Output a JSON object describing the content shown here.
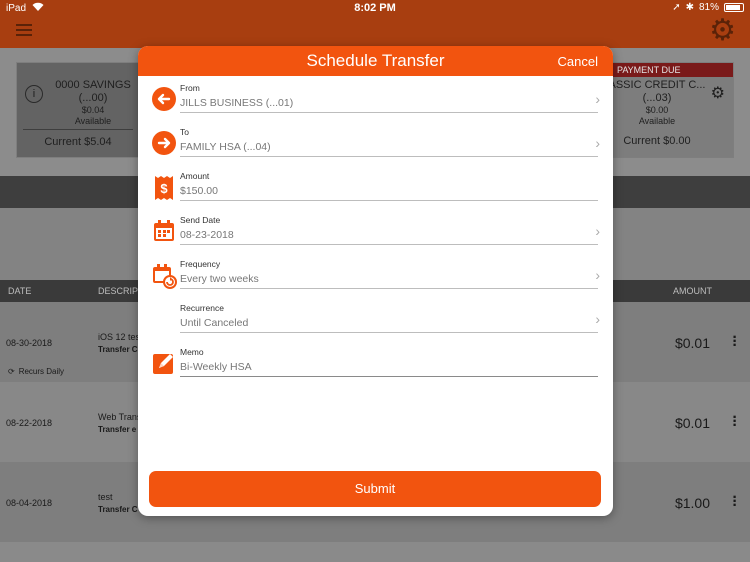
{
  "status_bar": {
    "device": "iPad",
    "time": "8:02 PM",
    "battery": "81%"
  },
  "background": {
    "left_account": {
      "name": "0000 SAVINGS",
      "mask": "(...00)",
      "balance": "$0.04",
      "available_label": "Available",
      "current": "Current $5.04"
    },
    "right_account": {
      "badge": "PAYMENT DUE",
      "name": "ASSIC CREDIT C...",
      "mask": "(...03)",
      "balance": "$0.00",
      "available_label": "Available",
      "current": "Current $0.00"
    },
    "table": {
      "col_date": "DATE",
      "col_desc": "DESCRIP",
      "col_amount": "AMOUNT",
      "rows": [
        {
          "date": "08-30-2018",
          "desc": "iOS 12 tes",
          "sub": "Transfer C",
          "amount": "$0.01",
          "recurs": "Recurs Daily"
        },
        {
          "date": "08-22-2018",
          "desc": "Web Trans",
          "sub": "Transfer e",
          "amount": "$0.01"
        },
        {
          "date": "08-04-2018",
          "desc": "test",
          "sub": "Transfer C",
          "amount": "$1.00"
        }
      ]
    }
  },
  "modal": {
    "title": "Schedule Transfer",
    "cancel": "Cancel",
    "from": {
      "label": "From",
      "value": "JILLS BUSINESS (...01)"
    },
    "to": {
      "label": "To",
      "value": "FAMILY HSA (...04)"
    },
    "amount": {
      "label": "Amount",
      "value": "$150.00"
    },
    "send_date": {
      "label": "Send Date",
      "value": "08-23-2018"
    },
    "frequency": {
      "label": "Frequency",
      "value": "Every two weeks"
    },
    "recurrence": {
      "label": "Recurrence",
      "value": "Until Canceled"
    },
    "memo": {
      "label": "Memo",
      "value": "Bi-Weekly HSA"
    },
    "submit": "Submit"
  },
  "colors": {
    "accent": "#f2540f",
    "header_bg": "#a83e10"
  }
}
